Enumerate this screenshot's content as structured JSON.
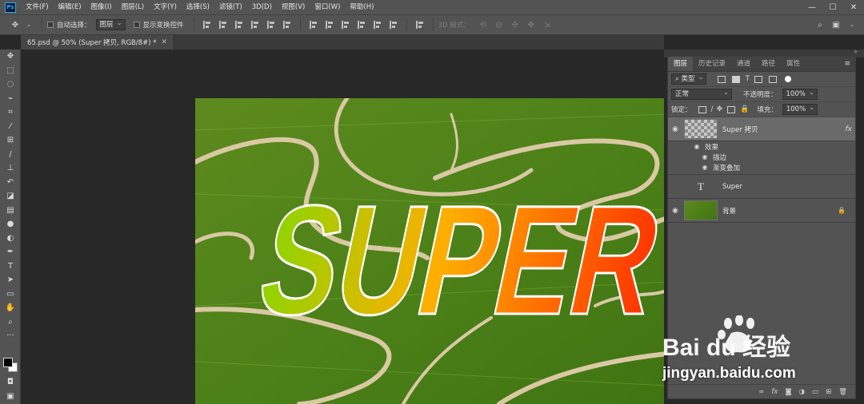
{
  "app": {
    "logo": "Ps"
  },
  "menubar": {
    "items": [
      "文件(F)",
      "编辑(E)",
      "图像(I)",
      "图层(L)",
      "文字(Y)",
      "选择(S)",
      "滤镜(T)",
      "3D(D)",
      "视图(V)",
      "窗口(W)",
      "帮助(H)"
    ],
    "window_controls": [
      "—",
      "☐",
      "✕"
    ]
  },
  "options": {
    "auto_select_label": "自动选择：",
    "auto_select_value": "图层",
    "show_transform_label": "显示变换控件",
    "mode_3d_label": "3D 模式："
  },
  "document": {
    "tab_title": "65.psd @ 50% (Super 拷贝, RGB/8#) *",
    "artwork_text": "SUPER",
    "gradient": {
      "start": "#8ed400",
      "mid": "#ffae00",
      "end": "#ff3300"
    }
  },
  "layers_panel": {
    "tabs": [
      "图层",
      "历史记录",
      "通道",
      "路径",
      "属性"
    ],
    "filter_label": "类型",
    "blend_mode": "正常",
    "opacity_label": "不透明度：",
    "opacity_value": "100%",
    "lock_label": "锁定：",
    "fill_label": "填充：",
    "fill_value": "100%",
    "layers": [
      {
        "name": "Super 拷贝",
        "fx": "fx",
        "selected": true
      },
      {
        "name": "Super",
        "type_icon": "T"
      },
      {
        "name": "背景"
      }
    ],
    "effects_label": "效果",
    "effects": [
      "描边",
      "渐变叠加"
    ]
  },
  "watermark": {
    "logo_text": "Bai du 经验",
    "url": "jingyan.baidu.com"
  }
}
